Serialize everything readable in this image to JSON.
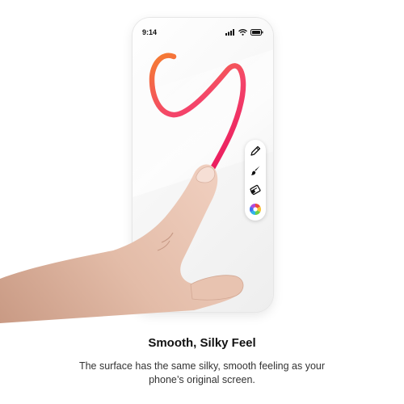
{
  "status_bar": {
    "time": "9:14"
  },
  "icons": {
    "signal": "cellular-signal-icon",
    "wifi": "wifi-icon",
    "battery": "battery-icon"
  },
  "toolbar": {
    "tools": [
      {
        "name": "pencil",
        "icon": "pencil-icon"
      },
      {
        "name": "brush",
        "icon": "paintbrush-icon"
      },
      {
        "name": "eraser",
        "icon": "eraser-icon"
      },
      {
        "name": "color",
        "icon": "color-wheel-icon"
      }
    ]
  },
  "drawing": {
    "stroke_colors": [
      "#f5842a",
      "#f4456a",
      "#e8125c"
    ]
  },
  "caption": {
    "title": "Smooth, Silky Feel",
    "line1": "The surface has the same silky, smooth feeling as your",
    "line2": "phone’s original screen."
  }
}
